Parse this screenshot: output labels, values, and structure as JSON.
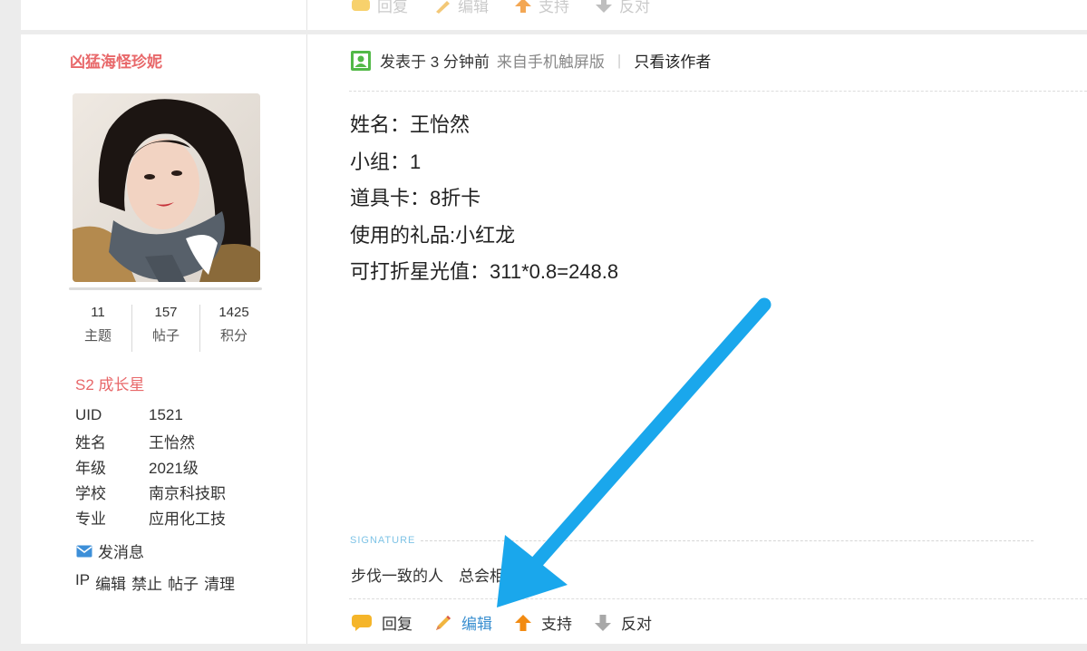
{
  "prev_post": {
    "actions": [
      {
        "label": "回复",
        "icon": "reply-icon"
      },
      {
        "label": "编辑",
        "icon": "pencil-icon"
      },
      {
        "label": "支持",
        "icon": "thumb-up-arrow-icon"
      },
      {
        "label": "反对",
        "icon": "thumb-down-arrow-icon"
      }
    ]
  },
  "author": {
    "name": "凶猛海怪珍妮",
    "stats": [
      {
        "value": "11",
        "label": "主题"
      },
      {
        "value": "157",
        "label": "帖子"
      },
      {
        "value": "1425",
        "label": "积分"
      }
    ],
    "rank": "S2 成长星",
    "profile": [
      {
        "key": "UID",
        "value": "1521"
      },
      {
        "key": "姓名",
        "value": "王怡然"
      },
      {
        "key": "年级",
        "value": "2021级"
      },
      {
        "key": "学校",
        "value": "南京科技职"
      },
      {
        "key": "专业",
        "value": "应用化工技"
      }
    ],
    "send_message": "发消息",
    "admin_links": [
      "IP",
      "编辑",
      "禁止",
      "帖子",
      "清理"
    ]
  },
  "post": {
    "time": "发表于 3 分钟前",
    "source": "来自手机触屏版",
    "only_author": "只看该作者",
    "lines": [
      "姓名：王怡然",
      "小组：1",
      "道具卡：8折卡",
      "使用的礼品:小红龙",
      "可打折星光值：311*0.8=248.8"
    ],
    "signature_label": "SIGNATURE",
    "signature_text": "步伐一致的人　总会相",
    "actions": [
      {
        "label": "回复",
        "icon": "reply-icon"
      },
      {
        "label": "编辑",
        "icon": "pencil-icon"
      },
      {
        "label": "支持",
        "icon": "thumb-up-arrow-icon"
      },
      {
        "label": "反对",
        "icon": "thumb-down-arrow-icon"
      }
    ]
  },
  "colors": {
    "author_name": "#e8686a",
    "edit_link": "#3a8fd0",
    "annotation_arrow": "#1aa7ec"
  }
}
